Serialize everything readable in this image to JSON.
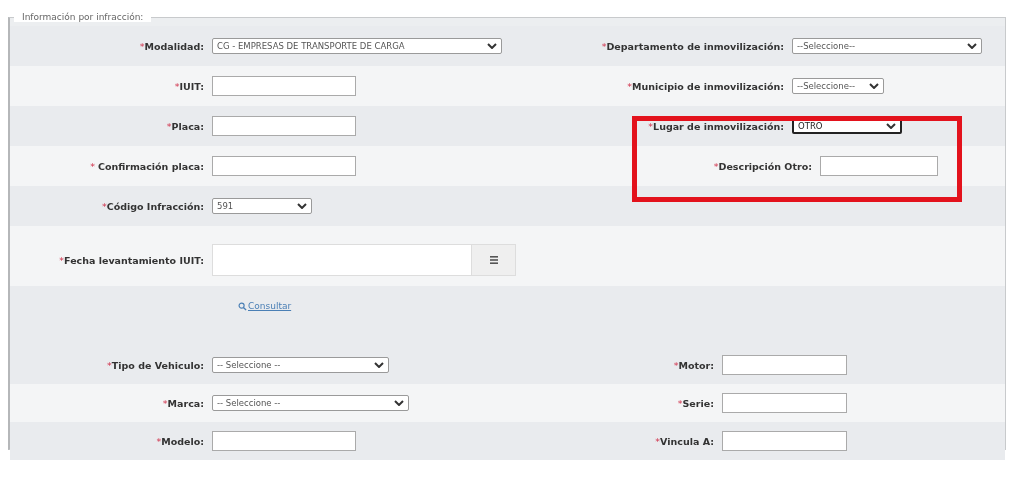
{
  "section": {
    "legend": "Información por infracción:",
    "rows": [
      {
        "left": {
          "mark": "*",
          "label": "Modalidad:",
          "kind": "select",
          "value": "CG - EMPRESAS DE TRANSPORTE DE CARGA",
          "focused": false
        },
        "right": {
          "mark": "*",
          "label": "Departamento de inmovilización:",
          "kind": "select",
          "value": "--Seleccione--",
          "focused": false,
          "highlighted": false
        }
      },
      {
        "left": {
          "mark": "*",
          "label": "IUIT:",
          "kind": "text"
        },
        "right": {
          "mark": "*",
          "label": "Municipio de inmovilización:",
          "kind": "select",
          "value": "--Seleccione--",
          "focused": false,
          "highlighted": false
        }
      },
      {
        "left": {
          "mark": "*",
          "label": "Placa:",
          "kind": "text"
        },
        "right": {
          "mark": "*",
          "label": "Lugar de inmovilización:",
          "kind": "select",
          "value": "OTRO",
          "focused": true,
          "highlighted": true
        }
      },
      {
        "left": {
          "mark": "* ",
          "label": "Confirmación placa:",
          "kind": "text"
        },
        "right": {
          "mark": "*",
          "label": "Descripción Otro:",
          "kind": "text",
          "highlighted": true
        }
      },
      {
        "left": {
          "mark": "*",
          "label": "Código Infracción:",
          "kind": "select",
          "value": "591",
          "focused": false
        }
      },
      {
        "left": {
          "mark": "*",
          "label": "Fecha levantamiento IUIT:",
          "kind": "date"
        }
      }
    ],
    "link": "Consultar"
  },
  "vehicle": {
    "rows": [
      {
        "left": {
          "mark": "*",
          "label": "Tipo de Vehiculo:",
          "kind": "select",
          "value": "-- Seleccione --",
          "focused": false
        },
        "right": {
          "mark": "*",
          "label": "Motor:",
          "kind": "text"
        }
      },
      {
        "left": {
          "mark": "*",
          "label": "Marca:",
          "kind": "select",
          "value": "-- Seleccione --",
          "focused": false
        },
        "right": {
          "mark": "*",
          "label": "Serie:",
          "kind": "text"
        }
      },
      {
        "left": {
          "mark": "*",
          "label": "Modelo:",
          "kind": "text"
        },
        "right": {
          "mark": "*",
          "label": "Vincula A:",
          "kind": "text"
        }
      }
    ]
  }
}
